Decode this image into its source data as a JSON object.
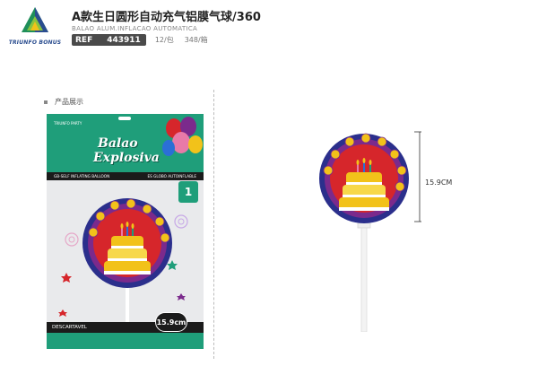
{
  "header": {
    "brand_name": "TRIUNFO BONUS",
    "title": "A款生日圆形自动充气铝膜气球/360",
    "subtitle": "BALAO ALUM.INFLACAO AUTOMATICA",
    "ref_label": "REF",
    "ref_code": "443911",
    "pack": "12/包",
    "carton": "348/箱"
  },
  "section": {
    "label": "产品展示"
  },
  "card": {
    "brand": "TRIUNFO PARTY",
    "title_line1": "Balao",
    "title_line2": "Explosiva",
    "strip_left": "GB-SELF INFLATING BALLOON",
    "strip_right": "ES GLOBO AUTOINFLABLE",
    "count": "1",
    "bottom_text": "DESCARTAVEL",
    "size": "15.9cm"
  },
  "product": {
    "height_label": "15.9CM"
  },
  "colors": {
    "card_green": "#1f9e7a",
    "balloon_blue": "#2b2f8c",
    "balloon_purple": "#7b2a8c",
    "cake_yellow": "#f2c21a",
    "cake_red": "#d6262b"
  }
}
